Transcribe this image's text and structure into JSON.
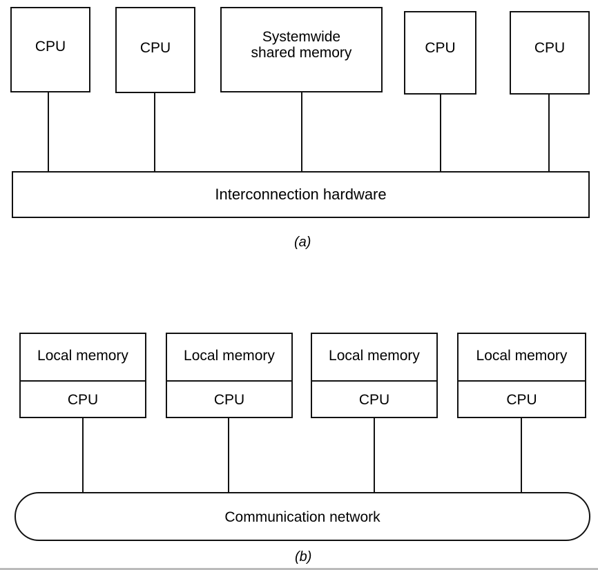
{
  "figure_a": {
    "nodes": [
      "CPU",
      "CPU",
      "Systemwide shared memory",
      "CPU",
      "CPU"
    ],
    "memory_line1": "Systemwide",
    "memory_line2": "shared memory",
    "bus": "Interconnection hardware",
    "caption_letter": "a"
  },
  "figure_b": {
    "nodes": [
      {
        "top": "Local memory",
        "bottom": "CPU"
      },
      {
        "top": "Local memory",
        "bottom": "CPU"
      },
      {
        "top": "Local memory",
        "bottom": "CPU"
      },
      {
        "top": "Local memory",
        "bottom": "CPU"
      }
    ],
    "network": "Communication network",
    "caption_letter": "b"
  }
}
